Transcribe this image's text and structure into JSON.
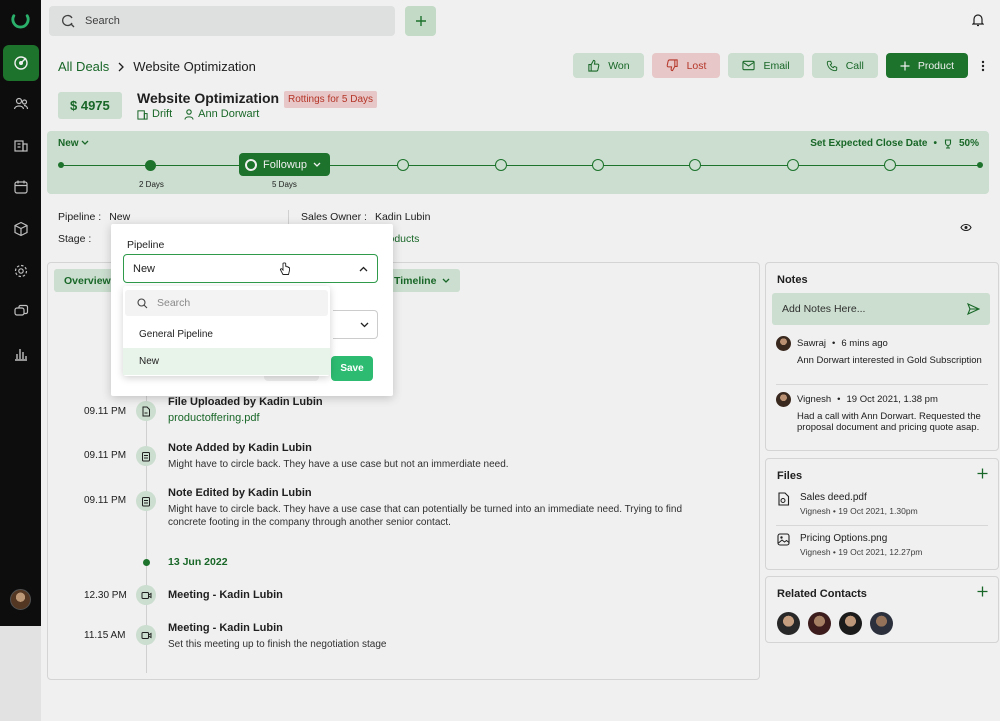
{
  "topbar": {
    "search_placeholder": "Search"
  },
  "breadcrumb": {
    "parent": "All Deals",
    "current": "Website Optimization"
  },
  "actions": {
    "won": "Won",
    "lost": "Lost",
    "email": "Email",
    "call": "Call",
    "product": "Product"
  },
  "deal": {
    "amount": "$ 4975",
    "title": "Website Optimization",
    "rot_badge": "Rottings for 5 Days",
    "company": "Drift",
    "contact": "Ann Dorwart"
  },
  "stagebar": {
    "current_pipeline_stage": "New",
    "close_date_label": "Set Expected Close Date",
    "probability": "50%",
    "active_stage": "Followup",
    "days_1": "2 Days",
    "days_2": "5 Days"
  },
  "info": {
    "pipeline_label": "Pipeline :",
    "pipeline_value": "New",
    "stage_label": "Stage :",
    "owner_label": "Sales Owner :",
    "owner_value": "Kadin Lubin",
    "products_partial": "roducts"
  },
  "tabs": {
    "overview": "Overview",
    "timeline": "Timeline"
  },
  "events": [
    {
      "time": "09.11 PM",
      "title": "File Uploaded by Kadin Lubin",
      "link": "productoffering.pdf"
    },
    {
      "time": "09.11 PM",
      "title": "Note Added by Kadin Lubin",
      "body": "Might have to circle back. They have a use case but not an immerdiate need."
    },
    {
      "time": "09.11 PM",
      "title": "Note Edited by Kadin Lubin",
      "body": "Might have to circle back. They have a use case that can potentially be turned into an immediate need. Trying to find concrete footing in the company through another senior contact."
    },
    {
      "date": "13 Jun 2022"
    },
    {
      "time": "12.30 PM",
      "title": "Meeting - Kadin Lubin"
    },
    {
      "time": "11.15 AM",
      "title": "Meeting - Kadin Lubin",
      "body": "Set this meeting up to finish the negotiation stage"
    }
  ],
  "notes": {
    "title": "Notes",
    "placeholder": "Add Notes Here...",
    "items": [
      {
        "author": "Sawraj",
        "time": "6 mins ago",
        "text": "Ann Dorwart interested in Gold Subscription"
      },
      {
        "author": "Vignesh",
        "time": "19 Oct 2021, 1.38 pm",
        "text": "Had a call with Ann Dorwart. Requested the proposal document and pricing quote asap."
      }
    ]
  },
  "files": {
    "title": "Files",
    "items": [
      {
        "name": "Sales deed.pdf",
        "meta": "Vignesh  •  19 Oct 2021, 1.30pm"
      },
      {
        "name": "Pricing Options.png",
        "meta": "Vignesh  •  19 Oct 2021, 12.27pm"
      }
    ]
  },
  "related": {
    "title": "Related Contacts"
  },
  "modal": {
    "label": "Pipeline",
    "selected": "New",
    "search_placeholder": "Search",
    "options": [
      "General Pipeline",
      "New"
    ],
    "save": "Save"
  },
  "colors": {
    "brand": "#1f7a2f",
    "brand_soft": "#d8ecdc",
    "danger": "#c0392b",
    "save": "#2dbb71"
  }
}
